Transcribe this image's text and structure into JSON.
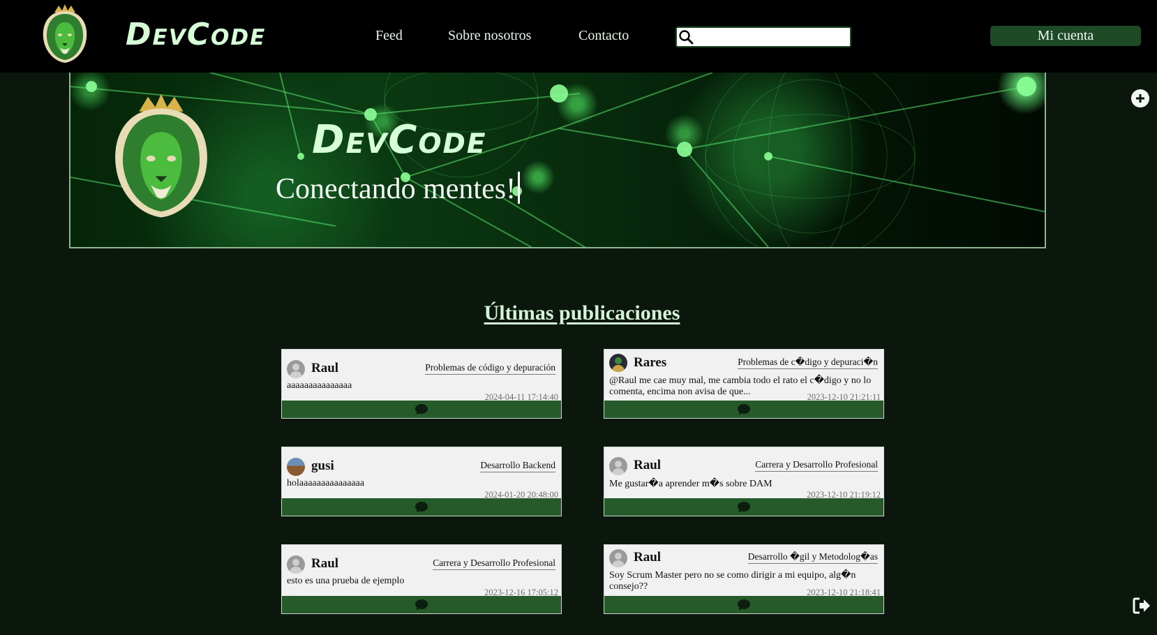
{
  "header": {
    "brand": "DevCode",
    "nav": [
      {
        "label": "Feed"
      },
      {
        "label": "Sobre nosotros"
      },
      {
        "label": "Contacto"
      }
    ],
    "search": {
      "placeholder": "",
      "value": ""
    },
    "account_label": "Mi cuenta"
  },
  "hero": {
    "brand": "DevCode",
    "tagline": "Conectando mentes!"
  },
  "section": {
    "title": "Últimas publicaciones"
  },
  "posts": [
    {
      "user": "Raul",
      "category": "Problemas de código y depuración",
      "text": "aaaaaaaaaaaaaaa",
      "date": "2024-04-11 17:14:40",
      "avatar": "default-avatar"
    },
    {
      "user": "Rares",
      "category": "Problemas de c�digo y depuraci�n",
      "text": "@Raul me cae muy mal, me cambia todo el rato el c�digo y no lo comenta, encima non avisa de que...",
      "date": "2023-12-10 21:21:11",
      "avatar": "lion-avatar"
    },
    {
      "user": "gusi",
      "category": "Desarrollo Backend",
      "text": "holaaaaaaaaaaaaaaa",
      "date": "2024-01-20 20:48:00",
      "avatar": "photo-avatar"
    },
    {
      "user": "Raul",
      "category": "Carrera y Desarrollo Profesional",
      "text": "Me gustar�a aprender m�s sobre DAM",
      "date": "2023-12-10 21:19:12",
      "avatar": "default-avatar"
    },
    {
      "user": "Raul",
      "category": "Carrera y Desarrollo Profesional",
      "text": "esto es una prueba de ejemplo",
      "date": "2023-12-16 17:05:12",
      "avatar": "default-avatar"
    },
    {
      "user": "Raul",
      "category": "Desarrollo �gil y Metodolog�as",
      "text": "Soy Scrum Master pero no se como dirigir a mi equipo, alg�n consejo??",
      "date": "2023-12-10 21:18:41",
      "avatar": "default-avatar"
    }
  ],
  "icons": {
    "search": "search-icon",
    "add": "plus-circle-icon",
    "logout": "logout-icon",
    "comment": "comment-icon",
    "logo": "lion-logo"
  },
  "colors": {
    "background": "#0b170c",
    "navbar": "#000000",
    "accent": "#1e4a26",
    "card_footer": "#275a2b",
    "brand_text": "#d6ffd8"
  }
}
